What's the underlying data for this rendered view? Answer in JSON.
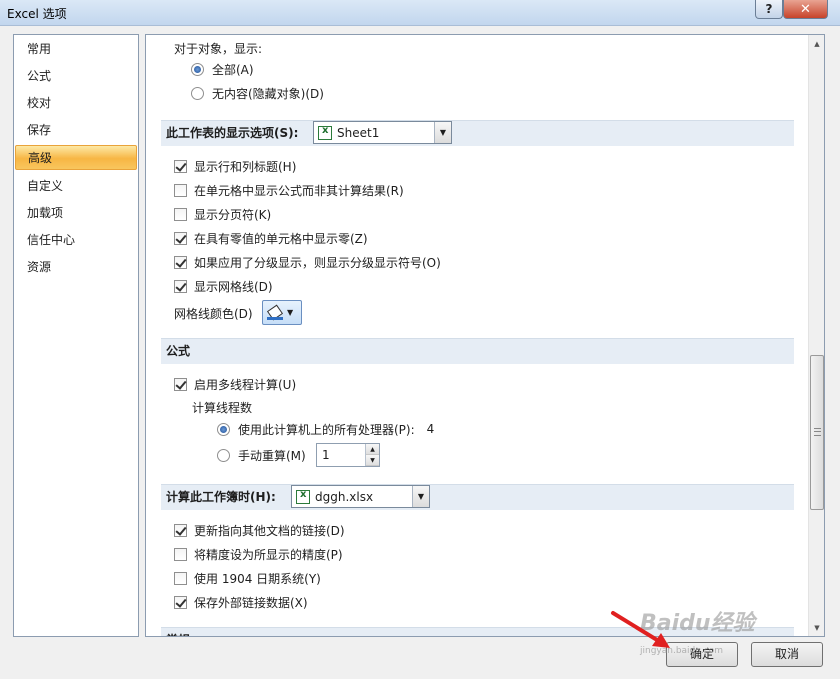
{
  "window": {
    "title": "Excel 选项",
    "help": "?",
    "close": "✕"
  },
  "nav": {
    "items": [
      "常用",
      "公式",
      "校对",
      "保存",
      "高级",
      "自定义",
      "加载项",
      "信任中心",
      "资源"
    ],
    "active_index": 4
  },
  "objects": {
    "label": "对于对象，显示:",
    "options": [
      "全部(A)",
      "无内容(隐藏对象)(D)"
    ],
    "selected_index": 0
  },
  "sheet_section": {
    "title": "此工作表的显示选项(S):",
    "sheet_value": "Sheet1",
    "checkboxes": [
      {
        "label": "显示行和列标题(H)",
        "checked": true
      },
      {
        "label": "在单元格中显示公式而非其计算结果(R)",
        "checked": false
      },
      {
        "label": "显示分页符(K)",
        "checked": false
      },
      {
        "label": "在具有零值的单元格中显示零(Z)",
        "checked": true
      },
      {
        "label": "如果应用了分级显示，则显示分级显示符号(O)",
        "checked": true
      },
      {
        "label": "显示网格线(D)",
        "checked": true
      }
    ],
    "gridline_color_label": "网格线颜色(D)"
  },
  "formula_section": {
    "title": "公式",
    "multithread": {
      "label": "启用多线程计算(U)",
      "checked": true
    },
    "threads_label": "计算线程数",
    "all_processors": {
      "label": "使用此计算机上的所有处理器(P):",
      "count": "4",
      "selected": true
    },
    "manual": {
      "label": "手动重算(M)",
      "value": "1",
      "selected": false
    }
  },
  "workbook_section": {
    "title": "计算此工作簿时(H):",
    "workbook_value": "dggh.xlsx",
    "checkboxes": [
      {
        "label": "更新指向其他文档的链接(D)",
        "checked": true
      },
      {
        "label": "将精度设为所显示的精度(P)",
        "checked": false
      },
      {
        "label": "使用 1904 日期系统(Y)",
        "checked": false
      },
      {
        "label": "保存外部链接数据(X)",
        "checked": true
      }
    ]
  },
  "general_section": {
    "title": "常规"
  },
  "buttons": {
    "ok": "确定",
    "cancel": "取消"
  },
  "watermark": {
    "text": "Baidu经验",
    "sub": "jingyan.baidu.com"
  }
}
